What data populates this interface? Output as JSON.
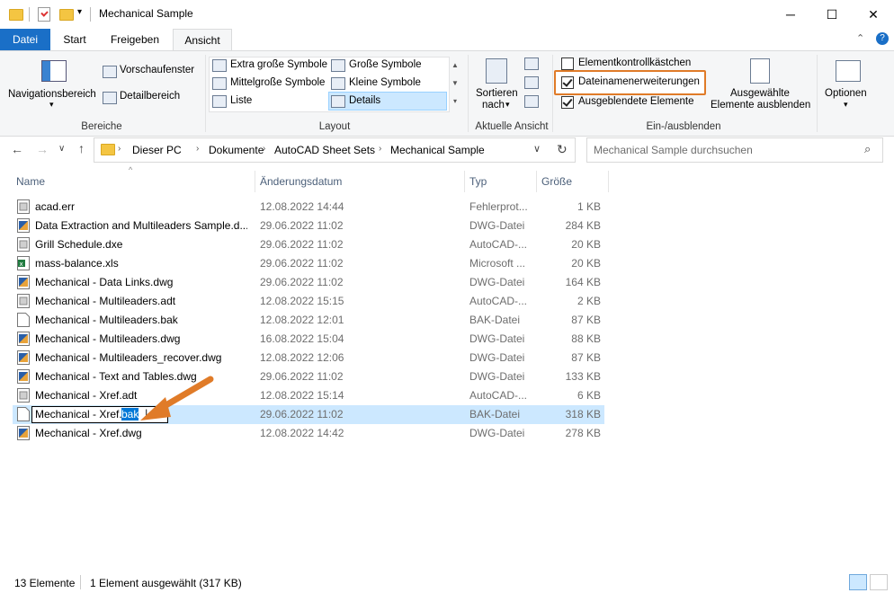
{
  "window": {
    "title": "Mechanical Sample"
  },
  "tabs": {
    "file": "Datei",
    "start": "Start",
    "share": "Freigeben",
    "view": "Ansicht"
  },
  "ribbon": {
    "panes": {
      "nav_pane": "Navigationsbereich",
      "preview_pane": "Vorschaufenster",
      "details_pane": "Detailbereich",
      "label": "Bereiche"
    },
    "layout": {
      "xl_icons": "Extra große Symbole",
      "large_icons": "Große Symbole",
      "medium_icons": "Mittelgroße Symbole",
      "small_icons": "Kleine Symbole",
      "list": "Liste",
      "details": "Details",
      "label": "Layout"
    },
    "current_view": {
      "sort_by_1": "Sortieren",
      "sort_by_2": "nach",
      "label": "Aktuelle Ansicht"
    },
    "show_hide": {
      "item_checkboxes": "Elementkontrollkästchen",
      "item_checkboxes_checked": false,
      "file_extensions": "Dateinamenerweiterungen",
      "file_extensions_checked": true,
      "hidden_items": "Ausgeblendete Elemente",
      "hidden_items_checked": true,
      "hide_selected_1": "Ausgewählte",
      "hide_selected_2": "Elemente ausblenden",
      "label": "Ein-/ausblenden"
    },
    "options": "Optionen"
  },
  "address": {
    "crumbs": [
      "Dieser PC",
      "Dokumente",
      "AutoCAD Sheet Sets",
      "Mechanical Sample"
    ],
    "search_placeholder": "Mechanical Sample durchsuchen"
  },
  "columns": {
    "name": "Name",
    "date": "Änderungsdatum",
    "type": "Typ",
    "size": "Größe"
  },
  "files": [
    {
      "name": "acad.err",
      "date": "12.08.2022 14:44",
      "type": "Fehlerprot...",
      "size": "1 KB",
      "icon": "text-file-icon"
    },
    {
      "name": "Data Extraction and Multileaders Sample.d...",
      "date": "29.06.2022 11:02",
      "type": "DWG-Datei",
      "size": "284 KB",
      "icon": "dwg-file-icon"
    },
    {
      "name": "Grill Schedule.dxe",
      "date": "29.06.2022 11:02",
      "type": "AutoCAD-...",
      "size": "20 KB",
      "icon": "text-file-icon"
    },
    {
      "name": "mass-balance.xls",
      "date": "29.06.2022 11:02",
      "type": "Microsoft ...",
      "size": "20 KB",
      "icon": "excel-file-icon"
    },
    {
      "name": "Mechanical - Data Links.dwg",
      "date": "29.06.2022 11:02",
      "type": "DWG-Datei",
      "size": "164 KB",
      "icon": "dwg-file-icon"
    },
    {
      "name": "Mechanical - Multileaders.adt",
      "date": "12.08.2022 15:15",
      "type": "AutoCAD-...",
      "size": "2 KB",
      "icon": "text-file-icon"
    },
    {
      "name": "Mechanical - Multileaders.bak",
      "date": "12.08.2022 12:01",
      "type": "BAK-Datei",
      "size": "87 KB",
      "icon": "blank-file-icon"
    },
    {
      "name": "Mechanical - Multileaders.dwg",
      "date": "16.08.2022 15:04",
      "type": "DWG-Datei",
      "size": "88 KB",
      "icon": "dwg-file-icon"
    },
    {
      "name": "Mechanical - Multileaders_recover.dwg",
      "date": "12.08.2022 12:06",
      "type": "DWG-Datei",
      "size": "87 KB",
      "icon": "dwg-file-icon"
    },
    {
      "name": "Mechanical - Text and Tables.dwg",
      "date": "29.06.2022 11:02",
      "type": "DWG-Datei",
      "size": "133 KB",
      "icon": "dwg-file-icon"
    },
    {
      "name": "Mechanical - Xref.adt",
      "date": "12.08.2022 15:14",
      "type": "AutoCAD-...",
      "size": "6 KB",
      "icon": "text-file-icon"
    },
    {
      "name": "Mechanical - Xref.bak",
      "date": "29.06.2022 11:02",
      "type": "BAK-Datei",
      "size": "318 KB",
      "icon": "blank-file-icon"
    },
    {
      "name": "Mechanical - Xref.dwg",
      "date": "12.08.2022 14:42",
      "type": "DWG-Datei",
      "size": "278 KB",
      "icon": "dwg-file-icon"
    }
  ],
  "rename": {
    "base": "Mechanical - Xref.",
    "ext": "bak"
  },
  "status": {
    "count": "13 Elemente",
    "selection": "1 Element ausgewählt (317 KB)"
  },
  "colors": {
    "accent": "#1a6fc7",
    "selection": "#cce8ff",
    "highlight": "#e07b28"
  }
}
